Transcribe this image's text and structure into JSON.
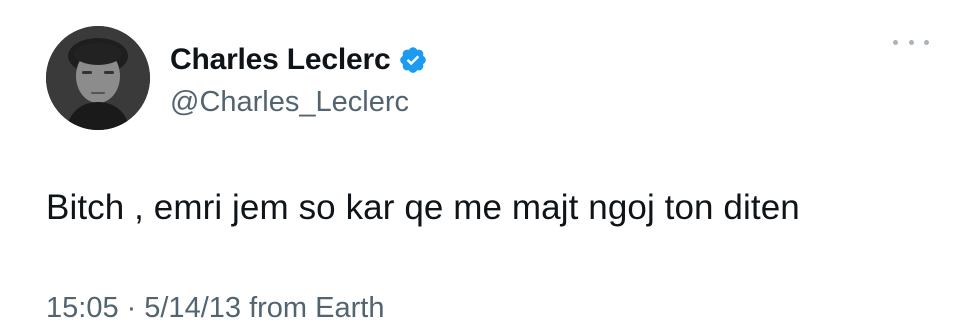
{
  "tweet": {
    "author": {
      "display_name": "Charles Leclerc",
      "handle": "@Charles_Leclerc",
      "verified": true,
      "avatar_icon": "profile-photo"
    },
    "more_icon": "ellipsis-icon",
    "text": "Bitch , emri jem so kar qe me majt ngoj ton diten",
    "meta": {
      "time": "15:05",
      "separator": "·",
      "date": "5/14/13",
      "source": "from Earth"
    }
  },
  "colors": {
    "text_primary": "#0f1419",
    "text_secondary": "#536471",
    "verified_blue": "#1d9bf0",
    "background": "#ffffff"
  }
}
